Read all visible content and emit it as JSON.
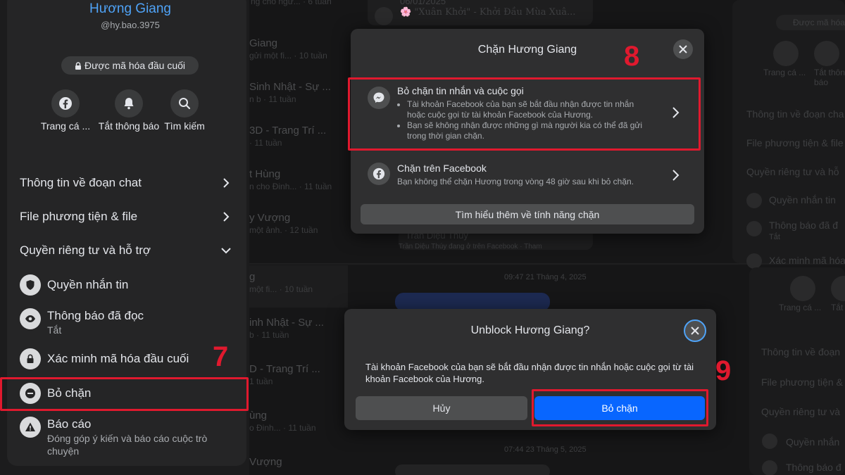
{
  "left_panel": {
    "profile_name": "Hương Giang",
    "profile_handle": "@hy.bao.3975",
    "e2e_label": "Được mã hóa đầu cuối",
    "quick_actions": [
      {
        "icon": "facebook-icon",
        "label": "Trang cá ..."
      },
      {
        "icon": "bell-icon",
        "label": "Tắt thông báo"
      },
      {
        "icon": "search-icon",
        "label": "Tìm kiếm"
      }
    ],
    "sections": [
      {
        "label": "Thông tin về đoạn chat",
        "state": "collapsed"
      },
      {
        "label": "File phương tiện & file",
        "state": "collapsed"
      },
      {
        "label": "Quyền riêng tư và hỗ trợ",
        "state": "expanded"
      }
    ],
    "privacy_items": [
      {
        "icon": "shield-icon",
        "title": "Quyền nhắn tin",
        "desc": ""
      },
      {
        "icon": "eye-icon",
        "title": "Thông báo đã đọc",
        "desc": "Tắt"
      },
      {
        "icon": "lock-icon",
        "title": "Xác minh mã hóa đầu cuối",
        "desc": ""
      },
      {
        "icon": "minus-circle-icon",
        "title": "Bỏ chặn",
        "desc": ""
      },
      {
        "icon": "warning-icon",
        "title": "Báo cáo",
        "desc": "Đóng góp ý kiến và báo cáo cuộc trò chuyện"
      }
    ]
  },
  "steps": {
    "step7": "7",
    "step8": "8",
    "step9": "9"
  },
  "block_dialog": {
    "title": "Chặn Hương Giang",
    "option_messenger": {
      "title": "Bỏ chặn tin nhắn và cuộc gọi",
      "bullets": [
        "Tài khoản Facebook của bạn sẽ bắt đầu nhận được tin nhắn hoặc cuộc gọi từ tài khoản Facebook của Hương.",
        "Bạn sẽ không nhận được những gì mà người kia có thể đã gửi trong thời gian chặn."
      ]
    },
    "option_facebook": {
      "title": "Chặn trên Facebook",
      "desc": "Bạn không thể chặn Hương trong vòng 48 giờ sau khi bỏ chặn."
    },
    "learn_more": "Tìm hiểu thêm về tính năng chặn"
  },
  "unblock_dialog": {
    "title": "Unblock Hương Giang?",
    "body": "Tài khoản Facebook của bạn sẽ bắt đầu nhận được tin nhắn hoặc cuộc gọi từ tài khoản Facebook của Hương.",
    "cancel_label": "Hủy",
    "confirm_label": "Bỏ chặn"
  },
  "background": {
    "chat_list_top": [
      {
        "name": "",
        "snippet": "ng cho ngư... · 6 tuần"
      },
      {
        "name": "Giang",
        "snippet": "gửi một fi... · 10 tuần"
      },
      {
        "name": "Sinh Nhật - Sự ...",
        "snippet": "n b · 11 tuần"
      },
      {
        "name": "3D - Trang Trí ...",
        "snippet": "· 11 tuần"
      },
      {
        "name": "t Hùng",
        "snippet": "n cho Đinh... · 11 tuần"
      },
      {
        "name": "y Vượng",
        "snippet": "một ảnh. · 12 tuần"
      }
    ],
    "chat_list_bottom": [
      {
        "name": "g",
        "snippet": "một fi... · 10 tuần"
      },
      {
        "name": "inh Nhật - Sự ...",
        "snippet": "b · 11 tuần"
      },
      {
        "name": "D - Trang Trí ...",
        "snippet": "1 tuần"
      },
      {
        "name": "ùng",
        "snippet": "o Đinh... · 11 tuần"
      },
      {
        "name": "Vượng",
        "snippet": ""
      }
    ],
    "top_date": "06/01/2025",
    "top_preview": "🌸 \"Xuân Khởi\" - Khởi Đầu Mùa Xuâ...",
    "behind_name": "Trần Diệu Thúy",
    "behind_snip": "Trần Diệu Thúy đang ở trên Facebook · Tham",
    "timestamp_1": "09:47 21 Tháng 4, 2025",
    "timestamp_2": "07:44 23 Tháng 5, 2025",
    "right_top": {
      "e2e": "Được mã hóa",
      "qa1": "Trang cá ...",
      "qa2": "Tắt thôn báo",
      "rows": [
        "Thông tin về đoạn cha",
        "File phương tiện & file",
        "Quyền riêng tư và hỗ"
      ],
      "items": [
        "Quyền nhắn tin",
        "Thông báo đã đ",
        "Tắt",
        "Xác minh mã hóa"
      ]
    },
    "right_bottom": {
      "qa1": "Trang cá ...",
      "qa2": "Tắt",
      "rows": [
        "Thông tin về đoạn",
        "File phương tiện &",
        "Quyền riêng tư và"
      ],
      "items": [
        "Quyền nhắn",
        "Thông báo đ"
      ]
    }
  },
  "colors": {
    "accent_blue": "#0866ff",
    "annotation_red": "#e0192e",
    "link_blue": "#4fa3f7"
  }
}
